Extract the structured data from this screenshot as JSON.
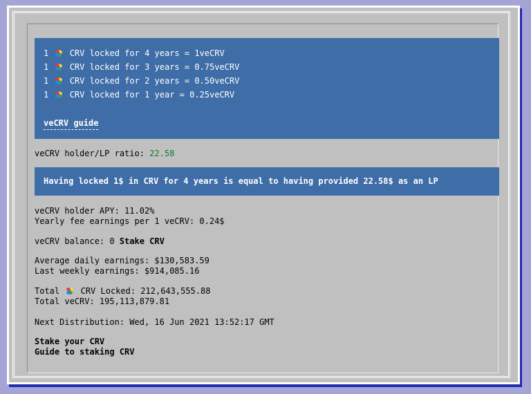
{
  "rates": [
    {
      "amount": "1",
      "text": "CRV locked for 4 years = 1veCRV"
    },
    {
      "amount": "1",
      "text": "CRV locked for 3 years = 0.75veCRV"
    },
    {
      "amount": "1",
      "text": "CRV locked for 2 years = 0.50veCRV"
    },
    {
      "amount": "1",
      "text": "CRV locked for 1 year = 0.25veCRV"
    }
  ],
  "guide_link": "veCRV guide",
  "ratio": {
    "label": "veCRV holder/LP ratio: ",
    "value": "22.58"
  },
  "ratio_banner": "Having locked 1$ in CRV for 4 years is equal to having provided 22.58$ as an LP",
  "apy": "veCRV holder APY: 11.02%",
  "yearly_fee": "Yearly fee earnings per 1 veCRV: 0.24$",
  "balance": {
    "label": "veCRV balance: 0 ",
    "action": "Stake CRV"
  },
  "avg_daily": "Average daily earnings: $130,583.59",
  "last_weekly": "Last weekly earnings: $914,085.16",
  "total_locked": {
    "prefix": "Total",
    "suffix": "CRV Locked: 212,643,555.88"
  },
  "total_vecrv": "Total veCRV: 195,113,879.81",
  "next_distribution": "Next Distribution: Wed, 16 Jun 2021 13:52:17 GMT",
  "links": {
    "stake": "Stake your CRV",
    "staking_guide": "Guide to staking CRV"
  },
  "colors": {
    "panel": "#3f6da7",
    "ratio_value": "#0f7a2c",
    "page_bg": "#a4a4d6"
  }
}
